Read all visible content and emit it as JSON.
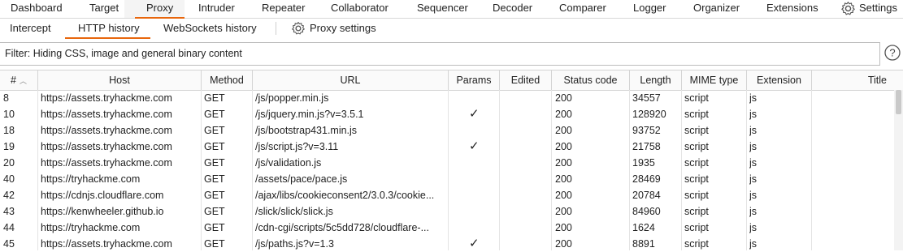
{
  "nav": {
    "tabs": [
      "Dashboard",
      "Target",
      "Proxy",
      "Intruder",
      "Repeater",
      "Collaborator",
      "Sequencer",
      "Decoder",
      "Comparer",
      "Logger",
      "Organizer",
      "Extensions"
    ],
    "settings_label": "Settings",
    "active_tab": "Proxy"
  },
  "subnav": {
    "tabs": [
      "Intercept",
      "HTTP history",
      "WebSockets history"
    ],
    "proxy_settings_label": "Proxy settings",
    "active_tab": "HTTP history"
  },
  "filter": {
    "text": "Filter: Hiding CSS, image and general binary content",
    "help_icon": "help-icon"
  },
  "table": {
    "columns": [
      "#",
      "Host",
      "Method",
      "URL",
      "Params",
      "Edited",
      "Status code",
      "Length",
      "MIME type",
      "Extension",
      "Title"
    ],
    "sort_column": "#",
    "sort_direction": "ascending",
    "rows": [
      {
        "num": "8",
        "host": "https://assets.tryhackme.com",
        "method": "GET",
        "url": "/js/popper.min.js",
        "params": "",
        "edited": "",
        "status": "200",
        "length": "34557",
        "mime": "script",
        "ext": "js",
        "title": ""
      },
      {
        "num": "10",
        "host": "https://assets.tryhackme.com",
        "method": "GET",
        "url": "/js/jquery.min.js?v=3.5.1",
        "params": "✓",
        "edited": "",
        "status": "200",
        "length": "128920",
        "mime": "script",
        "ext": "js",
        "title": ""
      },
      {
        "num": "18",
        "host": "https://assets.tryhackme.com",
        "method": "GET",
        "url": "/js/bootstrap431.min.js",
        "params": "",
        "edited": "",
        "status": "200",
        "length": "93752",
        "mime": "script",
        "ext": "js",
        "title": ""
      },
      {
        "num": "19",
        "host": "https://assets.tryhackme.com",
        "method": "GET",
        "url": "/js/script.js?v=3.11",
        "params": "✓",
        "edited": "",
        "status": "200",
        "length": "21758",
        "mime": "script",
        "ext": "js",
        "title": ""
      },
      {
        "num": "20",
        "host": "https://assets.tryhackme.com",
        "method": "GET",
        "url": "/js/validation.js",
        "params": "",
        "edited": "",
        "status": "200",
        "length": "1935",
        "mime": "script",
        "ext": "js",
        "title": ""
      },
      {
        "num": "40",
        "host": "https://tryhackme.com",
        "method": "GET",
        "url": "/assets/pace/pace.js",
        "params": "",
        "edited": "",
        "status": "200",
        "length": "28469",
        "mime": "script",
        "ext": "js",
        "title": ""
      },
      {
        "num": "42",
        "host": "https://cdnjs.cloudflare.com",
        "method": "GET",
        "url": "/ajax/libs/cookieconsent2/3.0.3/cookie...",
        "params": "",
        "edited": "",
        "status": "200",
        "length": "20784",
        "mime": "script",
        "ext": "js",
        "title": ""
      },
      {
        "num": "43",
        "host": "https://kenwheeler.github.io",
        "method": "GET",
        "url": "/slick/slick/slick.js",
        "params": "",
        "edited": "",
        "status": "200",
        "length": "84960",
        "mime": "script",
        "ext": "js",
        "title": ""
      },
      {
        "num": "44",
        "host": "https://tryhackme.com",
        "method": "GET",
        "url": "/cdn-cgi/scripts/5c5dd728/cloudflare-...",
        "params": "",
        "edited": "",
        "status": "200",
        "length": "1624",
        "mime": "script",
        "ext": "js",
        "title": ""
      },
      {
        "num": "45",
        "host": "https://assets.tryhackme.com",
        "method": "GET",
        "url": "/js/paths.js?v=1.3",
        "params": "✓",
        "edited": "",
        "status": "200",
        "length": "8891",
        "mime": "script",
        "ext": "js",
        "title": ""
      }
    ]
  },
  "colors": {
    "accent": "#e8660c",
    "header_bg": "#fafafa",
    "border": "#d4d4d4"
  }
}
